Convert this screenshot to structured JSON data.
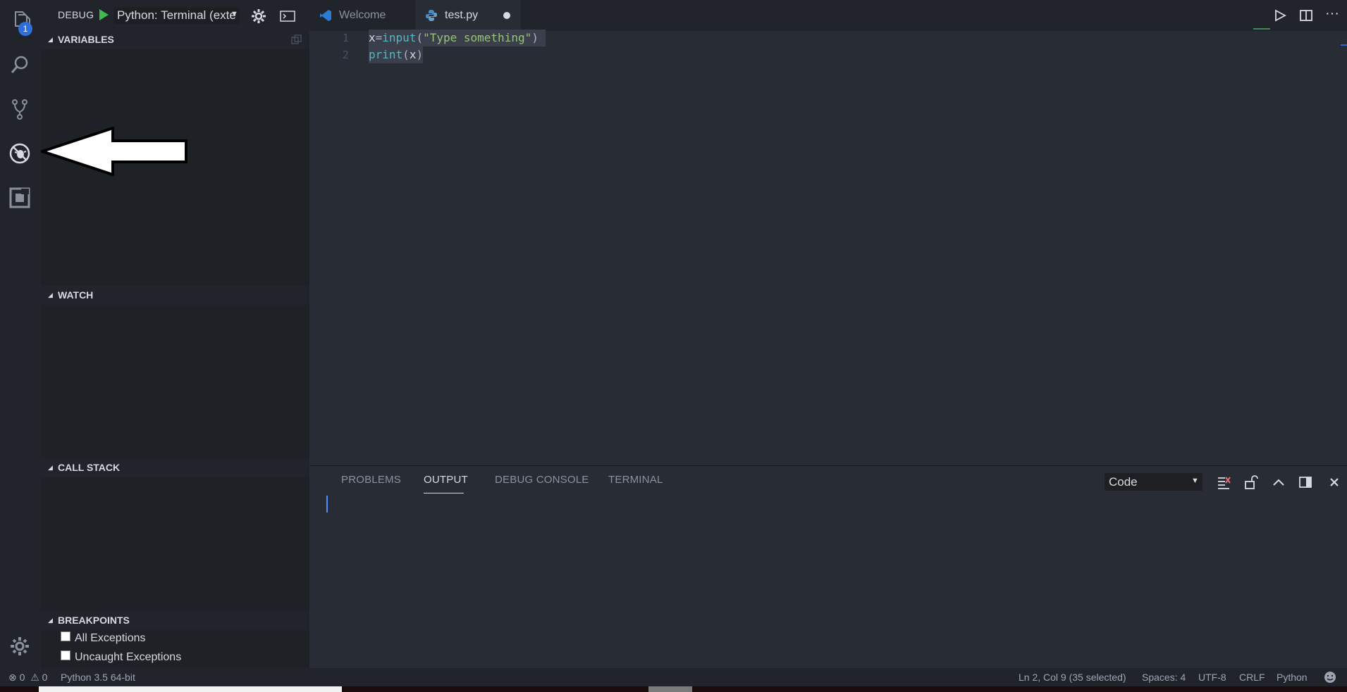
{
  "activity": {
    "explorer_badge": "1"
  },
  "debug": {
    "title": "DEBUG",
    "config_value": "Python: Terminal (exte"
  },
  "sidebar": {
    "sections": {
      "variables": "VARIABLES",
      "watch": "WATCH",
      "call_stack": "CALL STACK",
      "breakpoints": "BREAKPOINTS"
    },
    "breakpoints": [
      {
        "label": "All Exceptions",
        "checked": false
      },
      {
        "label": "Uncaught Exceptions",
        "checked": false
      }
    ]
  },
  "tabs": {
    "welcome": "Welcome",
    "test": "test.py"
  },
  "editor": {
    "line_numbers": [
      "1",
      "2"
    ],
    "line1": {
      "var": "x",
      "op": "=",
      "fn": "input",
      "open": "(",
      "str": "\"Type something\"",
      "close": ")"
    },
    "line2": {
      "fn": "print",
      "open": "(",
      "arg": "x",
      "close": ")"
    }
  },
  "panel": {
    "tabs": {
      "problems": "PROBLEMS",
      "output": "OUTPUT",
      "debug_console": "DEBUG CONSOLE",
      "terminal": "TERMINAL"
    },
    "output_channel": "Code"
  },
  "status": {
    "errors": "0",
    "warnings": "0",
    "interpreter": "Python 3.5 64-bit",
    "position": "Ln 2, Col 9 (35 selected)",
    "spaces": "Spaces: 4",
    "encoding": "UTF-8",
    "eol": "CRLF",
    "language": "Python"
  },
  "colors": {
    "editor_bg": "#282c34",
    "sidebar_bg": "#21252b",
    "badge": "#2f6fdb",
    "function": "#56b6c2",
    "string": "#98c379"
  }
}
